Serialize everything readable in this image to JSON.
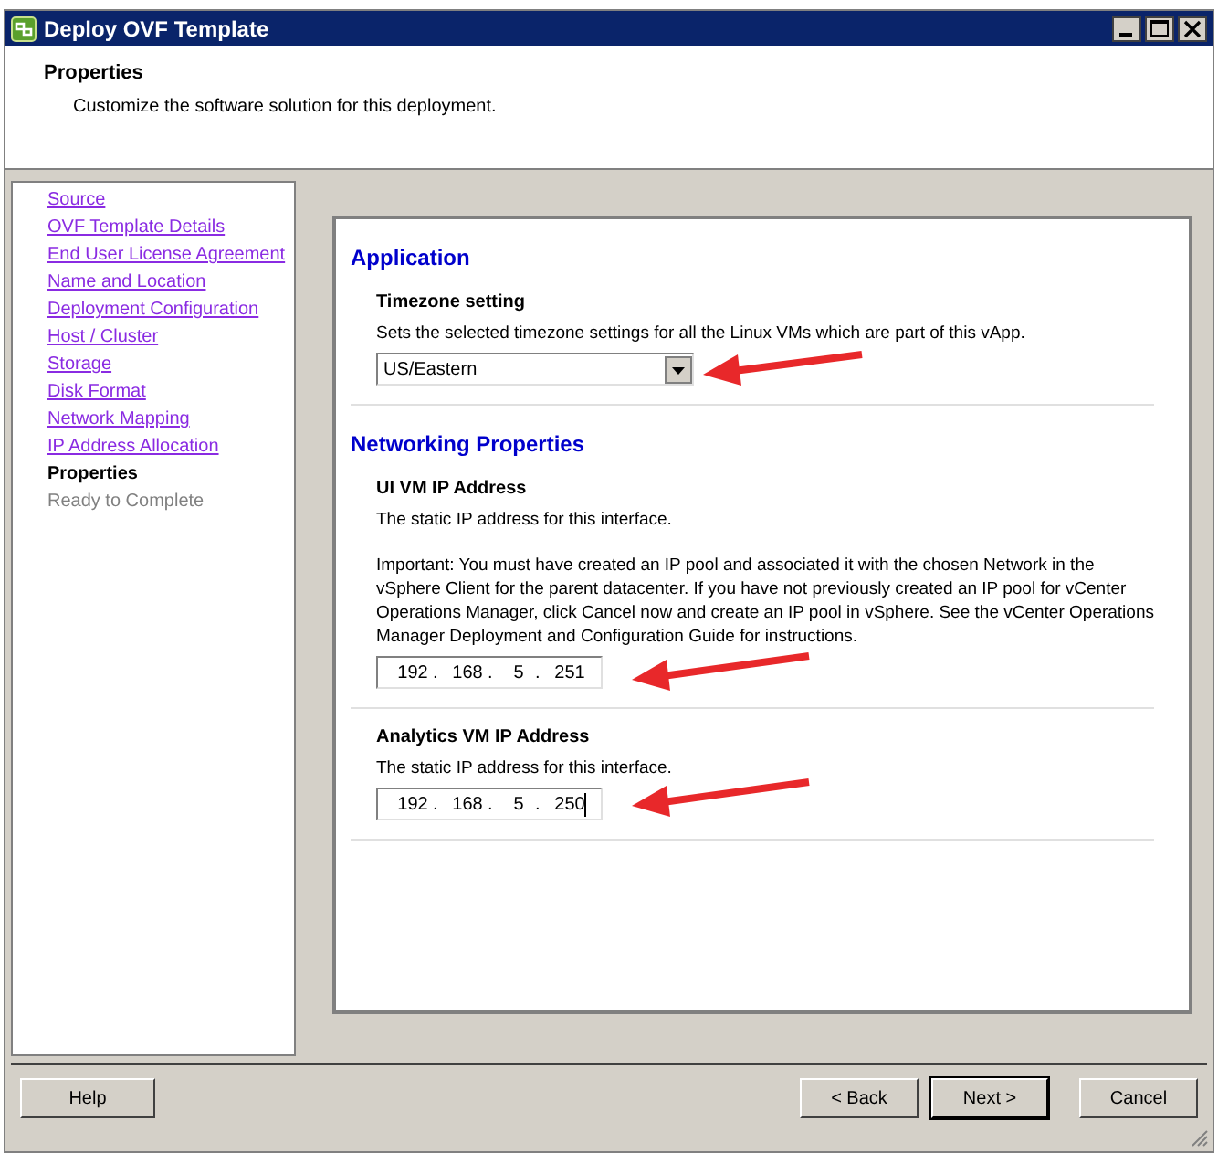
{
  "window": {
    "title": "Deploy OVF Template"
  },
  "header": {
    "title": "Properties",
    "subtitle": "Customize the software solution for this deployment."
  },
  "sidebar": {
    "items": [
      {
        "label": "Source",
        "selected": false,
        "completed": true
      },
      {
        "label": "OVF Template Details",
        "selected": false,
        "completed": true
      },
      {
        "label": "End User License Agreement",
        "selected": false,
        "completed": true
      },
      {
        "label": "Name and Location",
        "selected": false,
        "completed": true
      },
      {
        "label": "Deployment Configuration",
        "selected": false,
        "completed": true
      },
      {
        "label": "Host / Cluster",
        "selected": false,
        "completed": true
      },
      {
        "label": "Storage",
        "selected": false,
        "completed": true
      },
      {
        "label": "Disk Format",
        "selected": false,
        "completed": true
      },
      {
        "label": "Network Mapping",
        "selected": false,
        "completed": true
      },
      {
        "label": "IP Address Allocation",
        "selected": false,
        "completed": true
      },
      {
        "label": "Properties",
        "selected": true,
        "completed": false
      },
      {
        "label": "Ready to Complete",
        "selected": false,
        "completed": false
      }
    ]
  },
  "sections": [
    {
      "title": "Application",
      "properties": [
        {
          "kind": "dropdown",
          "label": "Timezone setting",
          "description": "Sets the selected timezone settings for all the Linux VMs which are part of this vApp.",
          "value": "US/Eastern"
        }
      ]
    },
    {
      "title": "Networking Properties",
      "properties": [
        {
          "kind": "ip",
          "label": "UI VM IP Address",
          "description": "The static IP address for this interface.",
          "note": "Important: You must have created an IP pool and associated it with the chosen Network in the vSphere Client for the parent datacenter. If you have not previously created an IP pool for vCenter Operations Manager, click Cancel now and create an IP pool in vSphere. See the vCenter Operations Manager Deployment and Configuration Guide for instructions.",
          "octets": [
            "192",
            "168",
            "5",
            "251"
          ],
          "separator": ".",
          "focused": false
        },
        {
          "kind": "ip",
          "label": "Analytics VM IP Address",
          "description": "The static IP address for this interface.",
          "octets": [
            "192",
            "168",
            "5",
            "250"
          ],
          "separator": ".",
          "focused": true
        }
      ]
    }
  ],
  "buttons": [
    {
      "label": "Help",
      "kind": "help"
    },
    {
      "label": "< Back",
      "kind": "nav"
    },
    {
      "label": "Next >",
      "kind": "default"
    },
    {
      "label": "Cancel",
      "kind": "nav"
    }
  ]
}
